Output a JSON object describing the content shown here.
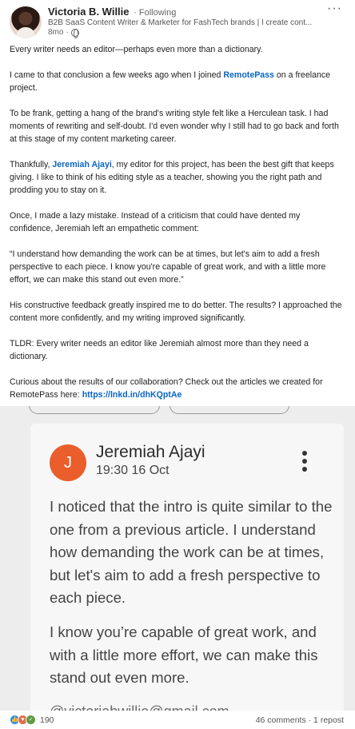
{
  "author": {
    "name": "Victoria B. Willie",
    "follow_state": "Following",
    "headline": "B2B SaaS Content Writer & Marketer for FashTech brands | I create cont...",
    "age": "8mo"
  },
  "post": {
    "p1": "Every writer needs an editor—perhaps even more than a dictionary.",
    "p2_before": "I came to that conclusion a few weeks ago when I joined ",
    "p2_mention": "RemotePass",
    "p2_after": " on a freelance project.",
    "p3": "To be frank, getting a hang of the brand's writing style felt like a Herculean task. I had moments of rewriting and self-doubt. I'd even wonder why I still had to go back and forth at this stage of my content marketing career.",
    "p4_before": "Thankfully, ",
    "p4_mention": "Jeremiah Ajayi",
    "p4_after": ", my editor for this project, has been the best gift that keeps giving. I like to think of his editing style as a teacher, showing you the right path and prodding you to stay on it.",
    "p5": "Once, I made a lazy mistake. Instead of a criticism that could have dented my confidence, Jeremiah left an empathetic comment:",
    "p6": "“I understand how demanding the work can be at times, but let's aim to add a fresh perspective to each piece. I know you're capable of great work, and with a little more effort, we can make this stand out even more.”",
    "p7": "His constructive feedback greatly inspired me to do better. The results? I approached the content more confidently, and my writing improved significantly.",
    "p8": "TLDR: Every writer needs an editor like Jeremiah almost more than they need a dictionary.",
    "p9_before": "Curious about the results of our collaboration? Check out the articles we created for RemotePass here: ",
    "p9_link": "https://lnkd.in/dhKQptAe"
  },
  "image": {
    "avatar_letter": "J",
    "sender": "Jeremiah Ajayi",
    "time": "19:30 16 Oct",
    "msg1": "I noticed that the intro is quite similar to the one from a previous article. I understand how demanding the work can be at times, but let's aim to add a fresh perspective to each piece.",
    "msg2": "I know you’re capable of great work, and with a little more effort, we can make this stand out even more.",
    "email_peek": "@victoriabwillie@gmail.com"
  },
  "footer": {
    "reaction_count": "190",
    "stats": "46 comments · 1 repost"
  },
  "colors": {
    "link": "#0a66c2",
    "avatar_orange": "#e95e2b",
    "like": "#378fe9",
    "love": "#df704d",
    "support": "#5f9b41"
  },
  "icons": [
    "globe-icon",
    "more-options-icon",
    "kebab-menu-icon",
    "like-reaction-icon",
    "love-reaction-icon",
    "support-reaction-icon"
  ]
}
